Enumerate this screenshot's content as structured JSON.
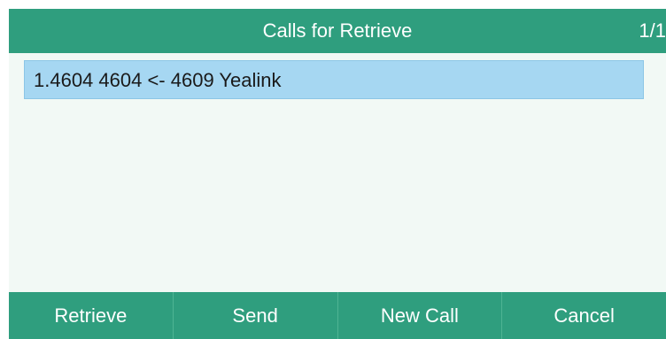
{
  "header": {
    "title": "Calls for Retrieve",
    "page_indicator": "1/1"
  },
  "list": {
    "items": [
      {
        "label": "1.4604 4604 <- 4609 Yealink",
        "selected": true
      }
    ]
  },
  "softkeys": [
    {
      "label": "Retrieve"
    },
    {
      "label": "Send"
    },
    {
      "label": "New Call"
    },
    {
      "label": "Cancel"
    }
  ],
  "colors": {
    "bar_green": "#2f9e7e",
    "screen_bg": "#f2f9f5",
    "selection_blue": "#a6d7f2"
  }
}
